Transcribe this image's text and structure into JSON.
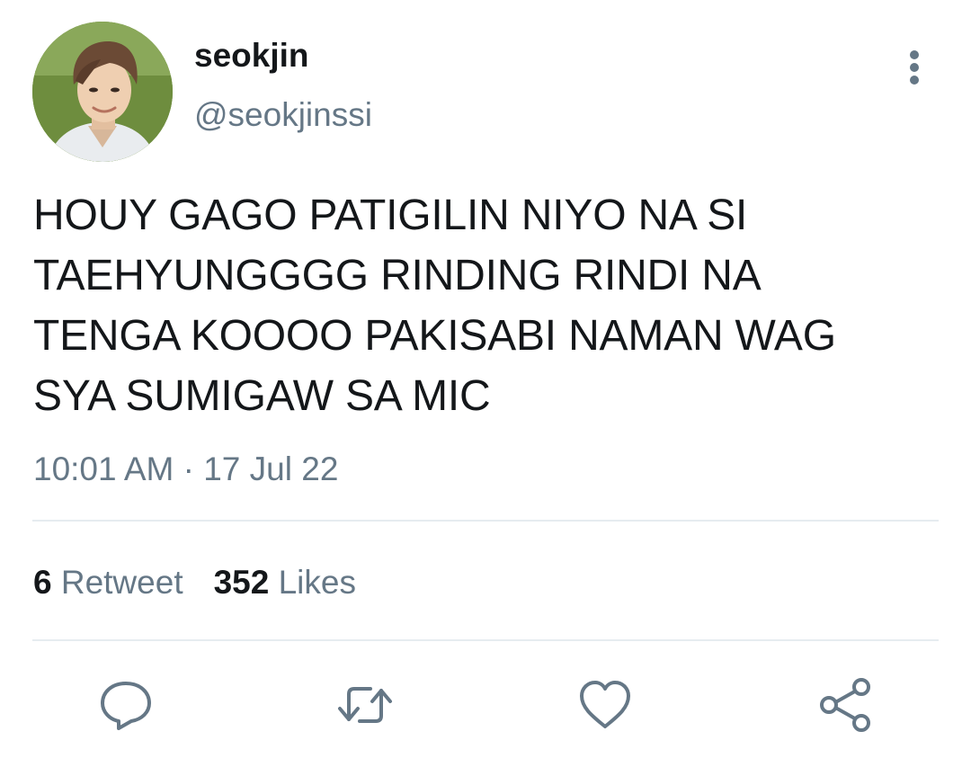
{
  "tweet": {
    "author": {
      "display_name": "seokjin",
      "handle": "@seokjinssi"
    },
    "text": "HOUY GAGO PATIGILIN NIYO NA SI\nTAEHYUNGGGG RINDING RINDI NA\nTENGA KOOOO PAKISABI NAMAN WAG\nSYA SUMIGAW SA MIC",
    "time": "10:01 AM",
    "separator": "·",
    "date": "17 Jul 22",
    "stats": {
      "retweet_count": "6",
      "retweet_label": "Retweet",
      "like_count": "352",
      "like_label": "Likes"
    }
  },
  "icons": {
    "more": "vertical-dots-icon",
    "reply": "reply-icon",
    "retweet": "retweet-icon",
    "like": "heart-icon",
    "share": "share-icon"
  },
  "colors": {
    "text_primary": "#14171a",
    "text_secondary": "#657786",
    "divider": "#e6ecf0"
  }
}
